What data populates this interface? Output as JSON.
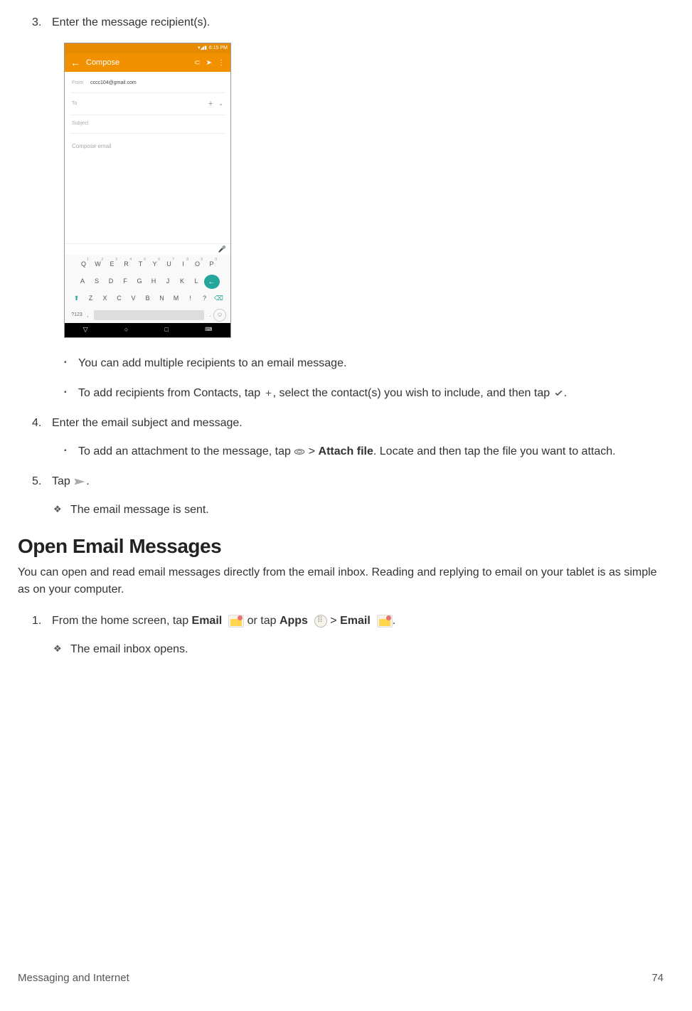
{
  "steps": {
    "s3": {
      "num": "3.",
      "text": "Enter the message recipient(s)."
    },
    "s3_bullets": {
      "b1": "You can add multiple recipients to an email message.",
      "b2_part1": "To add recipients from Contacts, tap ",
      "b2_part2": ", select the contact(s) you wish to include, and then tap ",
      "b2_part3": "."
    },
    "s4": {
      "num": "4.",
      "text": "Enter the email subject and message."
    },
    "s4_bullets": {
      "b1_part1": "To add an attachment to the message, tap ",
      "b1_part2": " > ",
      "b1_bold": "Attach file",
      "b1_part3": ". Locate and then tap the file you want to attach."
    },
    "s5": {
      "num": "5.",
      "text_part1": "Tap ",
      "text_part2": "."
    },
    "s5_result": "The email message is sent."
  },
  "section2": {
    "heading": "Open Email Messages",
    "intro": "You can open and read email messages directly from the email inbox. Reading and replying to email on your tablet is as simple as on your computer.",
    "step1": {
      "num": "1.",
      "p1": "From the home screen, tap ",
      "b1": "Email",
      "p2": " or tap ",
      "b2": "Apps",
      "p3": " > ",
      "b3": "Email",
      "p4": "."
    },
    "result": "The email inbox opens."
  },
  "footer": {
    "section": "Messaging and Internet",
    "page": "74"
  },
  "mock": {
    "status_time": "6:15 PM",
    "title": "Compose",
    "from_label": "From",
    "from_value": "cccc104@gmail.com",
    "to_label": "To",
    "subject_label": "Subject",
    "body_ph": "Compose email",
    "kb_sym": "?123",
    "row1": [
      "Q",
      "W",
      "E",
      "R",
      "T",
      "Y",
      "U",
      "I",
      "O",
      "P"
    ],
    "row1_nums": [
      "1",
      "2",
      "3",
      "4",
      "5",
      "6",
      "7",
      "8",
      "9",
      "0"
    ],
    "row2": [
      "A",
      "S",
      "D",
      "F",
      "G",
      "H",
      "J",
      "K",
      "L"
    ],
    "row3": [
      "Z",
      "X",
      "C",
      "V",
      "B",
      "N",
      "M",
      "!",
      "?"
    ]
  }
}
